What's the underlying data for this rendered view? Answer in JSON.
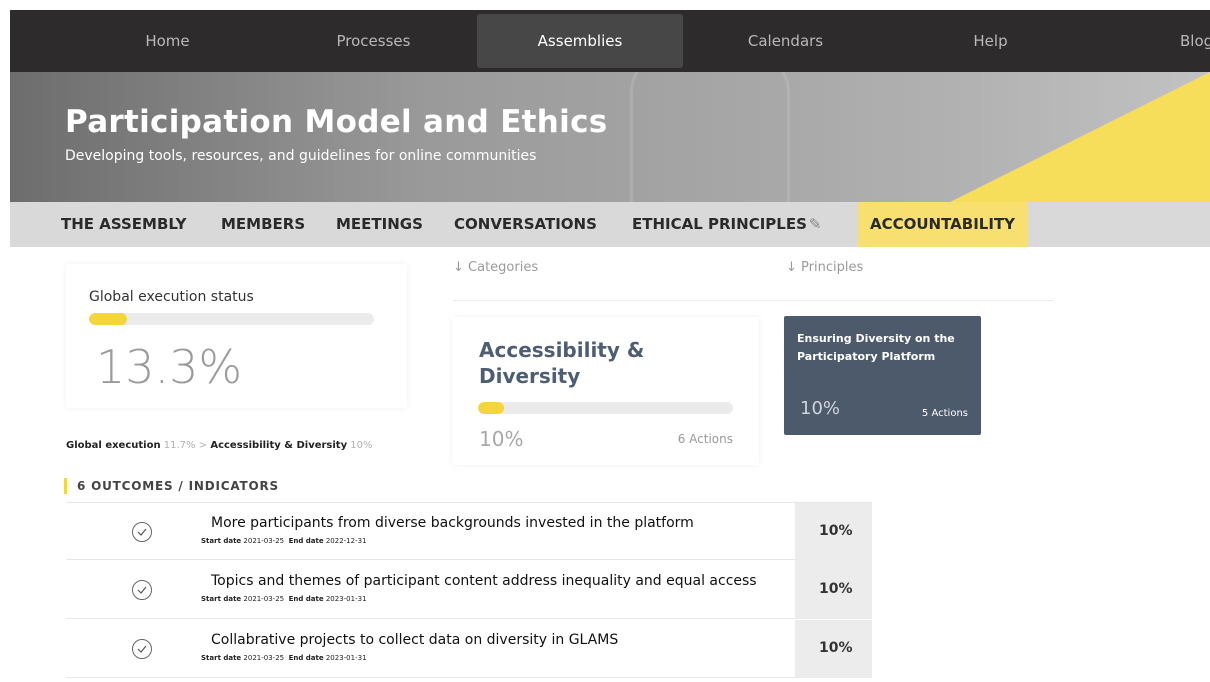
{
  "topnav": {
    "items": [
      {
        "label": "Home"
      },
      {
        "label": "Processes"
      },
      {
        "label": "Assemblies"
      },
      {
        "label": "Calendars"
      },
      {
        "label": "Help"
      },
      {
        "label": "Blog"
      }
    ],
    "active": "Assemblies"
  },
  "hero": {
    "title": "Participation Model and Ethics",
    "subtitle": "Developing tools, resources, and guidelines for online communities"
  },
  "subnav": {
    "tabs": [
      {
        "label": "THE ASSEMBLY"
      },
      {
        "label": "MEMBERS"
      },
      {
        "label": "MEETINGS"
      },
      {
        "label": "CONVERSATIONS"
      },
      {
        "label": "ETHICAL PRINCIPLES"
      },
      {
        "label": "ACCOUNTABILITY"
      }
    ],
    "active": "ACCOUNTABILITY",
    "pencil_icon": "pencil-icon"
  },
  "global_status": {
    "label": "Global execution status",
    "percent_text": "13.3%",
    "progress": 0.133
  },
  "breadcrumb": {
    "root_label": "Global execution",
    "root_value": "11.7%",
    "separator": ">",
    "current_label": "Accessibility & Diversity",
    "current_value": "10%"
  },
  "columns": {
    "categories_link": "↓ Categories",
    "principles_link": "↓ Principles"
  },
  "category_card": {
    "name": "Accessibility & Diversity",
    "percent_text": "10%",
    "progress": 0.1,
    "actions": "6 Actions"
  },
  "principle_card": {
    "name": "Ensuring Diversity on the Participatory Platform",
    "percent_text": "10%",
    "actions": "5 Actions"
  },
  "outcomes": {
    "heading": "6 OUTCOMES / INDICATORS",
    "start_label": "Start date",
    "end_label": "End date",
    "items": [
      {
        "title": "More participants from diverse backgrounds invested in the platform",
        "start": "2021-03-25",
        "end": "2022-12-31",
        "percent": "10%"
      },
      {
        "title": "Topics and themes of participant content address inequality and equal access",
        "start": "2021-03-25",
        "end": "2023-01-31",
        "percent": "10%"
      },
      {
        "title": "Collabrative projects to collect data on diversity in GLAMS",
        "start": "2021-03-25",
        "end": "2023-01-31",
        "percent": "10%"
      }
    ]
  },
  "colors": {
    "nav_bg": "#2d2b2b",
    "accent_yellow": "#f3d63b",
    "card_slate": "#4c5a6c",
    "subnav_bg": "#d9d9d9"
  }
}
